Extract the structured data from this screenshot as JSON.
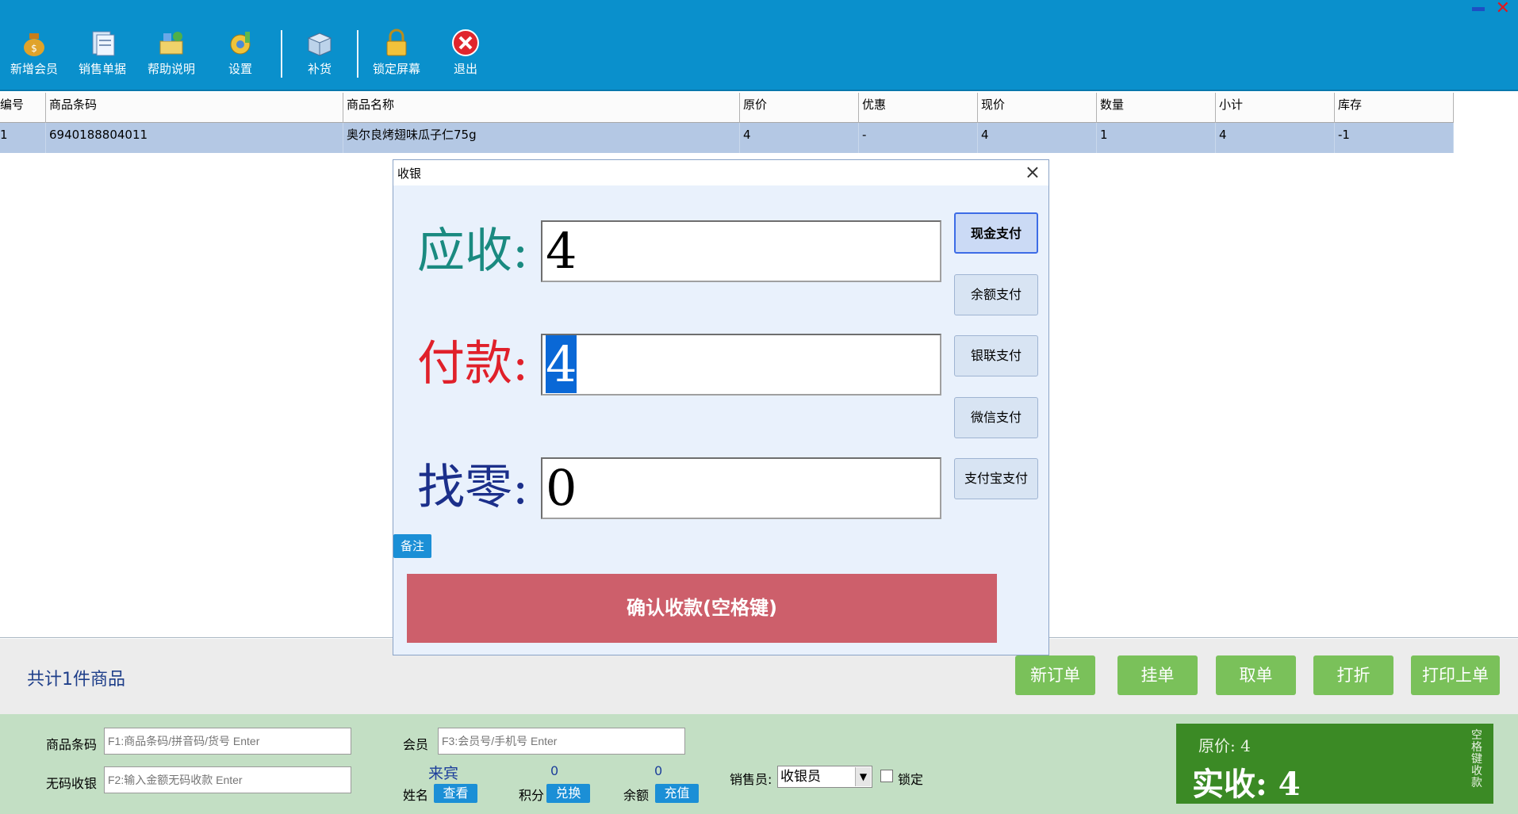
{
  "toolbar": {
    "buttons": [
      {
        "label": "新增会员",
        "icon": "money-bag-icon"
      },
      {
        "label": "销售单据",
        "icon": "document-icon"
      },
      {
        "label": "帮助说明",
        "icon": "help-icon"
      },
      {
        "label": "设置",
        "icon": "settings-icon"
      },
      {
        "label": "补货",
        "icon": "restock-box-icon"
      },
      {
        "label": "锁定屏幕",
        "icon": "padlock-icon"
      },
      {
        "label": "退出",
        "icon": "exit-icon"
      }
    ]
  },
  "grid": {
    "columns": [
      "编号",
      "商品条码",
      "商品名称",
      "原价",
      "优惠",
      "现价",
      "数量",
      "小计",
      "库存"
    ],
    "rows": [
      [
        "1",
        "6940188804011",
        "奥尔良烤翅味瓜子仁75g",
        "4",
        "-",
        "4",
        "1",
        "4",
        "-1"
      ]
    ]
  },
  "modal": {
    "title": "收银",
    "receivable_label": "应收:",
    "receivable_value": "4",
    "payment_label": "付款:",
    "payment_value": "4",
    "change_label": "找零:",
    "change_value": "0",
    "pay_methods": [
      "现金支付",
      "余额支付",
      "银联支付",
      "微信支付",
      "支付宝支付"
    ],
    "note_label": "备注",
    "confirm_label": "确认收款(空格键)",
    "colors": {
      "receivable": "#1a8a80",
      "payment": "#e0202a",
      "change": "#1b2f8a"
    }
  },
  "summary": {
    "count_text": "共计1件商品",
    "actions": [
      "新订单",
      "挂单",
      "取单",
      "打折",
      "打印上单"
    ]
  },
  "panel": {
    "barcode_label": "商品条码",
    "barcode_placeholder": "F1:商品条码/拼音码/货号 Enter",
    "nocode_label": "无码收银",
    "nocode_placeholder": "F2:输入金额无码收款 Enter",
    "member_label": "会员",
    "member_placeholder": "F3:会员号/手机号 Enter",
    "guest": "来宾",
    "name_label": "姓名",
    "view_label": "查看",
    "points_value": "0",
    "points_label": "积分",
    "redeem_label": "兑换",
    "balance_value": "0",
    "balance_label": "余额",
    "recharge_label": "充值",
    "seller_label": "销售员:",
    "seller_value": "收银员",
    "lock_label": "锁定",
    "original_price": "原价: 4",
    "actual_received": "实收: 4",
    "vertical_text": "空格键收款"
  }
}
